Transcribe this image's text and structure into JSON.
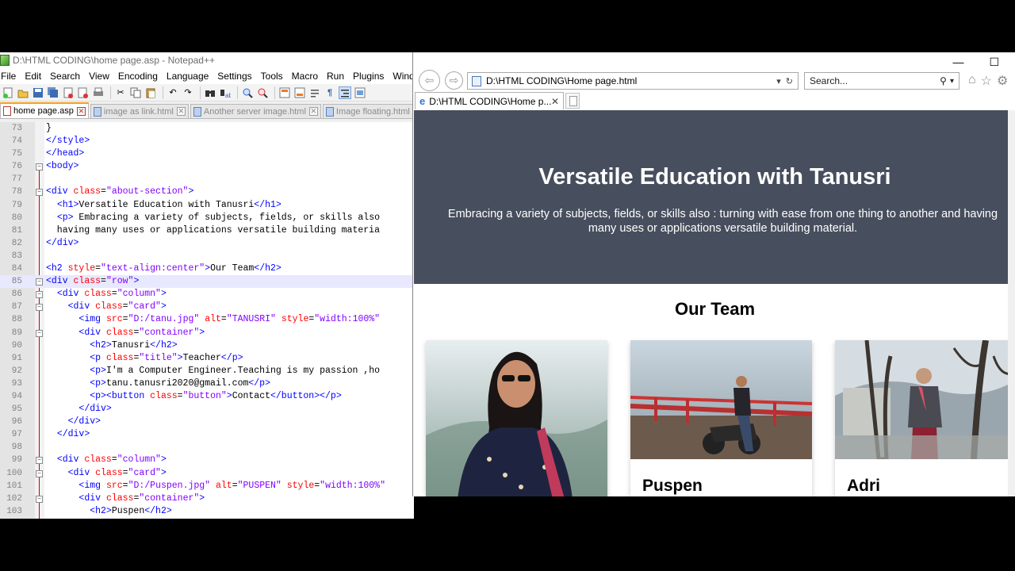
{
  "notepad": {
    "title": "D:\\HTML CODING\\home page.asp - Notepad++",
    "menu": [
      "File",
      "Edit",
      "Search",
      "View",
      "Encoding",
      "Language",
      "Settings",
      "Tools",
      "Macro",
      "Run",
      "Plugins",
      "Windo"
    ],
    "tabs": [
      {
        "label": "home page.asp",
        "active": true
      },
      {
        "label": "image as link.html",
        "active": false
      },
      {
        "label": "Another server image.html",
        "active": false
      },
      {
        "label": "Image floating.html",
        "active": false
      }
    ],
    "lines": [
      {
        "n": "73",
        "html": "}"
      },
      {
        "n": "74",
        "html": "<span class='tg'>&lt;/style&gt;</span>"
      },
      {
        "n": "75",
        "html": "<span class='tg'>&lt;/head&gt;</span>"
      },
      {
        "n": "76",
        "html": "<span class='tg'>&lt;body&gt;</span>",
        "fold": true
      },
      {
        "n": "77",
        "html": ""
      },
      {
        "n": "78",
        "html": "<span class='tg'>&lt;div</span> <span class='at'>class</span>=<span class='vl'>\"about-section\"</span><span class='tg'>&gt;</span>",
        "fold": true
      },
      {
        "n": "79",
        "html": "  <span class='tg'>&lt;h1&gt;</span>Versatile Education with Tanusri<span class='tg'>&lt;/h1&gt;</span>"
      },
      {
        "n": "80",
        "html": "  <span class='tg'>&lt;p&gt;</span> Embracing a variety of subjects, fields, or skills also"
      },
      {
        "n": "81",
        "html": "  having many uses or applications versatile building materia"
      },
      {
        "n": "82",
        "html": "<span class='tg'>&lt;/div&gt;</span>"
      },
      {
        "n": "83",
        "html": ""
      },
      {
        "n": "84",
        "html": "<span class='tg'>&lt;h2</span> <span class='at'>style</span>=<span class='vl'>\"text-align:center\"</span><span class='tg'>&gt;</span>Our Team<span class='tg'>&lt;/h2&gt;</span>"
      },
      {
        "n": "85",
        "html": "<span class='tg'>&lt;div</span> <span class='at'>class</span>=<span class='vl'>\"row\"</span><span class='tg'>&gt;</span>",
        "fold": true,
        "current": true
      },
      {
        "n": "86",
        "html": "  <span class='tg'>&lt;div</span> <span class='at'>class</span>=<span class='vl'>\"column\"</span><span class='tg'>&gt;</span>",
        "fold": true
      },
      {
        "n": "87",
        "html": "    <span class='tg'>&lt;div</span> <span class='at'>class</span>=<span class='vl'>\"card\"</span><span class='tg'>&gt;</span>",
        "fold": true
      },
      {
        "n": "88",
        "html": "      <span class='tg'>&lt;img</span> <span class='at'>src</span>=<span class='vl'>\"D:/tanu.jpg\"</span> <span class='at'>alt</span>=<span class='vl'>\"TANUSRI\"</span> <span class='at'>style</span>=<span class='vl'>\"width:100%\"</span>"
      },
      {
        "n": "89",
        "html": "      <span class='tg'>&lt;div</span> <span class='at'>class</span>=<span class='vl'>\"container\"</span><span class='tg'>&gt;</span>",
        "fold": true
      },
      {
        "n": "90",
        "html": "        <span class='tg'>&lt;h2&gt;</span>Tanusri<span class='tg'>&lt;/h2&gt;</span>"
      },
      {
        "n": "91",
        "html": "        <span class='tg'>&lt;p</span> <span class='at'>class</span>=<span class='vl'>\"title\"</span><span class='tg'>&gt;</span>Teacher<span class='tg'>&lt;/p&gt;</span>"
      },
      {
        "n": "92",
        "html": "        <span class='tg'>&lt;p&gt;</span>I'm a Computer Engineer.Teaching is my passion ,ho"
      },
      {
        "n": "93",
        "html": "        <span class='tg'>&lt;p&gt;</span>tanu.tanusri2020@gmail.com<span class='tg'>&lt;/p&gt;</span>"
      },
      {
        "n": "94",
        "html": "        <span class='tg'>&lt;p&gt;&lt;button</span> <span class='at'>class</span>=<span class='vl'>\"button\"</span><span class='tg'>&gt;</span>Contact<span class='tg'>&lt;/button&gt;&lt;/p&gt;</span>"
      },
      {
        "n": "95",
        "html": "      <span class='tg'>&lt;/div&gt;</span>"
      },
      {
        "n": "96",
        "html": "    <span class='tg'>&lt;/div&gt;</span>"
      },
      {
        "n": "97",
        "html": "  <span class='tg'>&lt;/div&gt;</span>"
      },
      {
        "n": "98",
        "html": ""
      },
      {
        "n": "99",
        "html": "  <span class='tg'>&lt;div</span> <span class='at'>class</span>=<span class='vl'>\"column\"</span><span class='tg'>&gt;</span>",
        "fold": true
      },
      {
        "n": "100",
        "html": "    <span class='tg'>&lt;div</span> <span class='at'>class</span>=<span class='vl'>\"card\"</span><span class='tg'>&gt;</span>",
        "fold": true
      },
      {
        "n": "101",
        "html": "      <span class='tg'>&lt;img</span> <span class='at'>src</span>=<span class='vl'>\"D:/Puspen.jpg\"</span> <span class='at'>alt</span>=<span class='vl'>\"PUSPEN\"</span> <span class='at'>style</span>=<span class='vl'>\"width:100%\"</span>"
      },
      {
        "n": "102",
        "html": "      <span class='tg'>&lt;div</span> <span class='at'>class</span>=<span class='vl'>\"container\"</span><span class='tg'>&gt;</span>",
        "fold": true
      },
      {
        "n": "103",
        "html": "        <span class='tg'>&lt;h2&gt;</span>Puspen<span class='tg'>&lt;/h2&gt;</span>"
      }
    ]
  },
  "ie": {
    "address": "D:\\HTML CODING\\Home page.html",
    "search_placeholder": "Search...",
    "tab_title": "D:\\HTML CODING\\Home p...",
    "page": {
      "heading": "Versatile Education with Tanusri",
      "intro": "Embracing a variety of subjects, fields, or skills also : turning with ease from one thing to another and having many uses or applications versatile building material.",
      "team_title": "Our Team",
      "cards": [
        {
          "name": "",
          "photo": "woman-sunglasses-photo"
        },
        {
          "name": "Puspen",
          "photo": "man-motorcycle-photo"
        },
        {
          "name": "Adri",
          "photo": "child-trees-photo"
        }
      ]
    }
  },
  "colors": {
    "about_bg": "#474e5d",
    "tag": "#0000ff",
    "attr": "#ff0000",
    "value": "#8000ff"
  }
}
